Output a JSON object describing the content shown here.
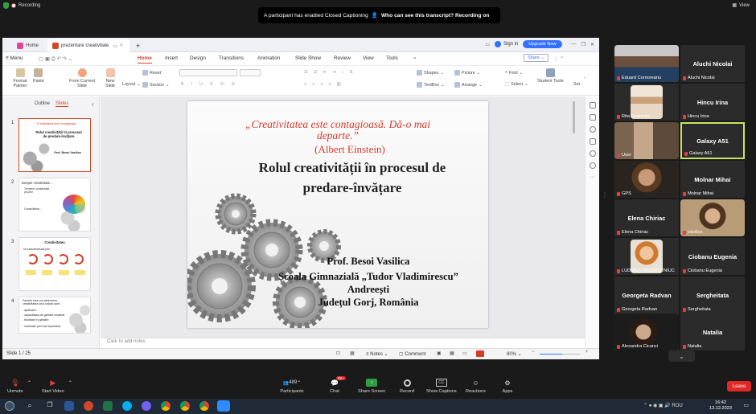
{
  "topbar": {
    "recording": "Recording",
    "view": "View"
  },
  "notice": {
    "text": "A participant has enabled Closed Captioning",
    "link": "Who can see this transcript? Recording on"
  },
  "app": {
    "tabs": {
      "home": "Home",
      "doc": "prezentare creativitate"
    },
    "signin": "Sign in",
    "upgrade": "Upgrade Now",
    "share": "Share",
    "menu_label": "Menu",
    "menu": [
      "Home",
      "Insert",
      "Design",
      "Transitions",
      "Animation",
      "Slide Show",
      "Review",
      "View",
      "Tools"
    ],
    "ribbon": {
      "format_painter": "Format Painter",
      "paste": "Paste",
      "from_current": "From Current Slide",
      "new_slide": "New Slide",
      "layout": "Layout",
      "reset": "Reset",
      "section": "Section",
      "shapes": "Shapes",
      "picture": "Picture",
      "textbox": "TextBox",
      "arrange": "Arrange",
      "find": "Find",
      "select": "Select",
      "student_tools": "Student Tools",
      "set": "Set"
    },
    "panel_tabs": {
      "outline": "Outline",
      "slides": "Slides"
    },
    "thumbs": [
      {
        "num": "1",
        "lines": [
          "\"Creativitatea este contagioasă.",
          "Rolul creativității în procesul de predare-învățare",
          "Prof. Besoi Vasilica"
        ]
      },
      {
        "num": "2",
        "lines": [
          "Despre creativitate...",
          "Termenul creativitate provine",
          "Creativitatea ..."
        ]
      },
      {
        "num": "3",
        "lines": [
          "Creativitatea",
          "se caracterizează prin:"
        ]
      },
      {
        "num": "4",
        "lines": [
          "Factorii care pot determina creativitatea unui individ sunt:",
          "- aptitudini",
          "- capacitatea de gândire creativă",
          "- fluiditate în gândire",
          "- motivație (cel mai important)"
        ]
      }
    ],
    "slide": {
      "quote": "„Creativitatea este contagioasă. Dă-o mai departe.”",
      "author": "(Albert Einstein)",
      "title": "Rolul creativității în procesul de predare-învățare",
      "lines": [
        "Prof. Besoi Vasilica",
        "Școala Gimnazială „Tudor Vladimirescu”",
        "Andreești",
        "Județul Gorj, România"
      ]
    },
    "notes_placeholder": "Click to add notes",
    "status": {
      "slide": "Slide 1 / 25",
      "notes": "Notes",
      "comment": "Comment",
      "zoom": "80%"
    }
  },
  "gallery": [
    {
      "label": "Eduard Cornoreanu",
      "big": ""
    },
    {
      "label": "Aluchi Nicolai",
      "big": "Aluchi Nicolai"
    },
    {
      "label": "Rita Godoroja",
      "big": ""
    },
    {
      "label": "Hincu Irina",
      "big": "Hincu Irina"
    },
    {
      "label": "User",
      "big": ""
    },
    {
      "label": "Galaxy A51",
      "big": "Galaxy A51"
    },
    {
      "label": "GPS",
      "big": ""
    },
    {
      "label": "Molnar Mihai",
      "big": "Molnar Mihai"
    },
    {
      "label": "Elena Chiriac",
      "big": "Elena Chiriac"
    },
    {
      "label": "vasilica",
      "big": ""
    },
    {
      "label": "LUDMILA ZAVOROTNIUC",
      "big": ""
    },
    {
      "label": "Ciobanu Eugenia",
      "big": "Ciobanu Eugenia"
    },
    {
      "label": "Georgeta Radvan",
      "big": "Georgeta Radvan"
    },
    {
      "label": "Sergheitata",
      "big": "Sergheitata"
    },
    {
      "label": "Alexandra Cicanci",
      "big": ""
    },
    {
      "label": "Natalia",
      "big": "Natalia"
    }
  ],
  "controls": {
    "unmute": "Unmute",
    "start_video": "Start Video",
    "participants": "Participants",
    "participants_count": "489",
    "chat": "Chat",
    "chat_badge": "99+",
    "share_screen": "Share Screen",
    "record": "Record",
    "show_captions": "Show Captions",
    "reactions": "Reactions",
    "apps": "Apps",
    "leave": "Leave"
  },
  "taskbar": {
    "lang": "ROU",
    "time": "16:42",
    "date": "13.12.2023"
  },
  "colors": {
    "accent_wps": "#d24726",
    "active_speaker": "#c8e65a",
    "leave": "#e02828",
    "zoom_blue": "#3370ff"
  }
}
